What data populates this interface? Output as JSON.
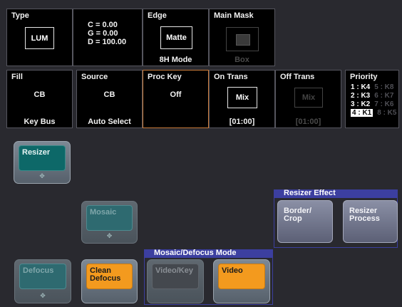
{
  "type": {
    "title": "Type",
    "value": "LUM"
  },
  "cge": {
    "c": "C  = 0.00",
    "g": "G  = 0.00",
    "d": "D  = 100.00"
  },
  "edge": {
    "title": "Edge",
    "value": "Matte",
    "mode": "8H Mode"
  },
  "main_mask": {
    "title": "Main Mask",
    "sub": "Box"
  },
  "fill": {
    "title": "Fill",
    "value": "CB",
    "sub": "Key Bus"
  },
  "source": {
    "title": "Source",
    "value": "CB",
    "sub": "Auto Select"
  },
  "proc_key": {
    "title": "Proc Key",
    "value": "Off"
  },
  "on_trans": {
    "title": "On Trans",
    "value": "Mix",
    "time": "[01:00]"
  },
  "off_trans": {
    "title": "Off Trans",
    "value": "Mix",
    "time": "[01:00]"
  },
  "priority": {
    "title": "Priority",
    "rows": [
      {
        "a": "1 : K4",
        "b": "5 : K8"
      },
      {
        "a": "2 : K3",
        "b": "6 : K7"
      },
      {
        "a": "3 : K2",
        "b": "7 : K6"
      },
      {
        "a": "4 : K1",
        "b": "8 : K5"
      }
    ]
  },
  "buttons": {
    "resizer": "Resizer",
    "mosaic": "Mosaic",
    "defocus": "Defocus",
    "clean_defocus": "Clean Defocus",
    "video_key": "Video/Key",
    "video": "Video",
    "border_crop": "Border/ Crop",
    "resizer_process": "Resizer Process"
  },
  "groups": {
    "resizer_effect": "Resizer Effect",
    "mosaic_defocus_mode": "Mosaic/Defocus Mode"
  },
  "icons": {
    "move": "move-arrows-icon"
  },
  "colors": {
    "teal": "#0d6868",
    "orange": "#f39a1e",
    "highlight": "#c97a3a",
    "group": "#3c3fa0"
  }
}
